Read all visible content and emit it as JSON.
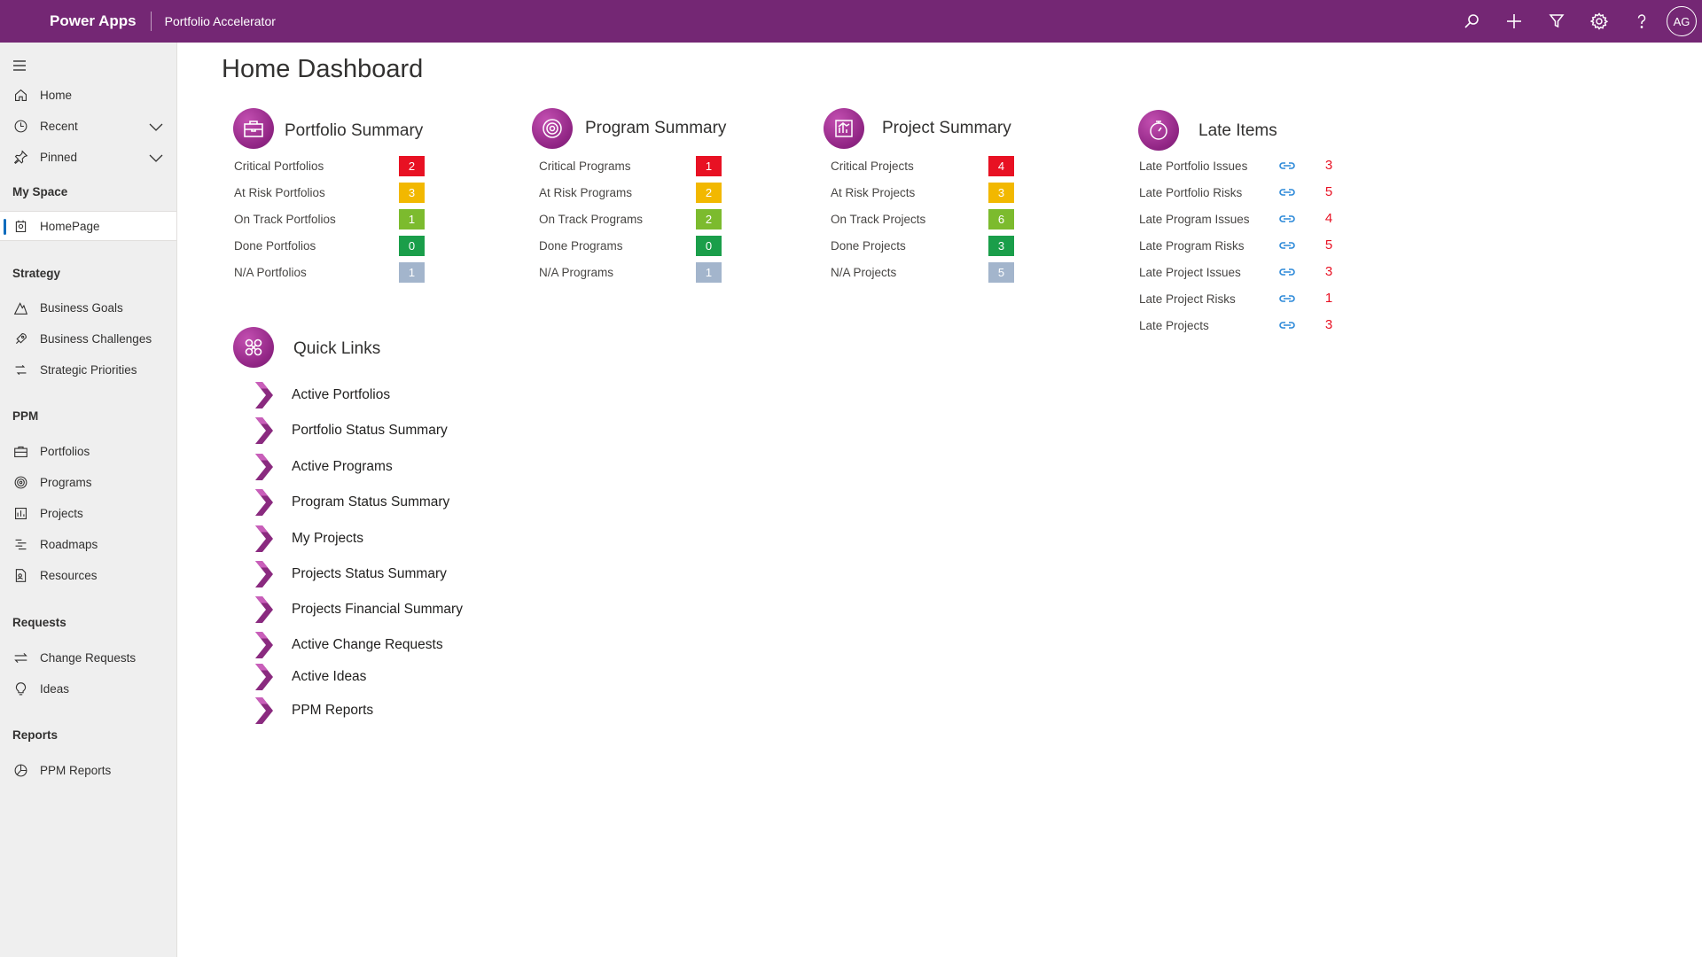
{
  "topbar": {
    "app_name": "Power Apps",
    "app_title": "Portfolio Accelerator",
    "user_initials": "AG",
    "icons": [
      "search-icon",
      "add-icon",
      "filter-icon",
      "settings-icon",
      "help-icon"
    ]
  },
  "sidebar": {
    "top_items": [
      {
        "label": "Home",
        "icon": "home-icon"
      },
      {
        "label": "Recent",
        "icon": "clock-icon",
        "has_chevron": true
      },
      {
        "label": "Pinned",
        "icon": "pin-icon",
        "has_chevron": true
      }
    ],
    "sections": [
      {
        "title": "My Space",
        "items": [
          {
            "label": "HomePage",
            "icon": "homepage-icon",
            "active": true
          }
        ]
      },
      {
        "title": "Strategy",
        "items": [
          {
            "label": "Business Goals",
            "icon": "goals-icon"
          },
          {
            "label": "Business Challenges",
            "icon": "challenges-icon"
          },
          {
            "label": "Strategic Priorities",
            "icon": "priorities-icon"
          }
        ]
      },
      {
        "title": "PPM",
        "items": [
          {
            "label": "Portfolios",
            "icon": "briefcase-icon"
          },
          {
            "label": "Programs",
            "icon": "programs-icon"
          },
          {
            "label": "Projects",
            "icon": "projects-icon"
          },
          {
            "label": "Roadmaps",
            "icon": "roadmap-icon"
          },
          {
            "label": "Resources",
            "icon": "resources-icon"
          }
        ]
      },
      {
        "title": "Requests",
        "items": [
          {
            "label": "Change Requests",
            "icon": "change-icon"
          },
          {
            "label": "Ideas",
            "icon": "lightbulb-icon"
          }
        ]
      },
      {
        "title": "Reports",
        "items": [
          {
            "label": "PPM Reports",
            "icon": "reports-icon"
          }
        ]
      }
    ]
  },
  "main": {
    "page_title": "Home Dashboard",
    "summaries": [
      {
        "title": "Portfolio Summary",
        "icon": "briefcase-icon",
        "rows": [
          {
            "label": "Critical Portfolios",
            "value": "2",
            "status": "critical"
          },
          {
            "label": "At Risk Portfolios",
            "value": "3",
            "status": "at-risk"
          },
          {
            "label": "On Track Portfolios",
            "value": "1",
            "status": "on-track"
          },
          {
            "label": "Done Portfolios",
            "value": "0",
            "status": "done"
          },
          {
            "label": "N/A Portfolios",
            "value": "1",
            "status": "na"
          }
        ]
      },
      {
        "title": "Program Summary",
        "icon": "programs-icon",
        "rows": [
          {
            "label": "Critical Programs",
            "value": "1",
            "status": "critical"
          },
          {
            "label": "At Risk Programs",
            "value": "2",
            "status": "at-risk"
          },
          {
            "label": "On Track Programs",
            "value": "2",
            "status": "on-track"
          },
          {
            "label": "Done Programs",
            "value": "0",
            "status": "done"
          },
          {
            "label": "N/A Programs",
            "value": "1",
            "status": "na"
          }
        ]
      },
      {
        "title": "Project Summary",
        "icon": "projects-icon",
        "rows": [
          {
            "label": "Critical Projects",
            "value": "4",
            "status": "critical"
          },
          {
            "label": "At Risk Projects",
            "value": "3",
            "status": "at-risk"
          },
          {
            "label": "On Track Projects",
            "value": "6",
            "status": "on-track"
          },
          {
            "label": "Done Projects",
            "value": "3",
            "status": "done"
          },
          {
            "label": "N/A Projects",
            "value": "5",
            "status": "na"
          }
        ]
      }
    ],
    "late_items": {
      "title": "Late Items",
      "icon": "stopwatch-icon",
      "rows": [
        {
          "label": "Late Portfolio Issues",
          "value": "3"
        },
        {
          "label": "Late Portfolio Risks",
          "value": "5"
        },
        {
          "label": "Late Program Issues",
          "value": "4"
        },
        {
          "label": "Late Program Risks",
          "value": "5"
        },
        {
          "label": "Late Project Issues",
          "value": "3"
        },
        {
          "label": "Late Project Risks",
          "value": "1"
        },
        {
          "label": "Late Projects",
          "value": "3"
        }
      ]
    },
    "quick_links": {
      "title": "Quick Links",
      "icon": "links-icon",
      "items": [
        "Active Portfolios",
        "Portfolio Status Summary",
        "Active Programs",
        "Program Status Summary",
        "My Projects",
        "Projects Status Summary",
        "Projects Financial Summary",
        "Active Change Requests",
        "Active Ideas",
        "PPM Reports"
      ]
    }
  },
  "colors": {
    "brand": "#742774",
    "critical": "#e81123",
    "at-risk": "#f2b800",
    "on-track": "#7cbb2e",
    "done": "#1a9e4a",
    "na": "#a3b5cc",
    "link": "#2b88d8",
    "late-count": "#e81123"
  }
}
